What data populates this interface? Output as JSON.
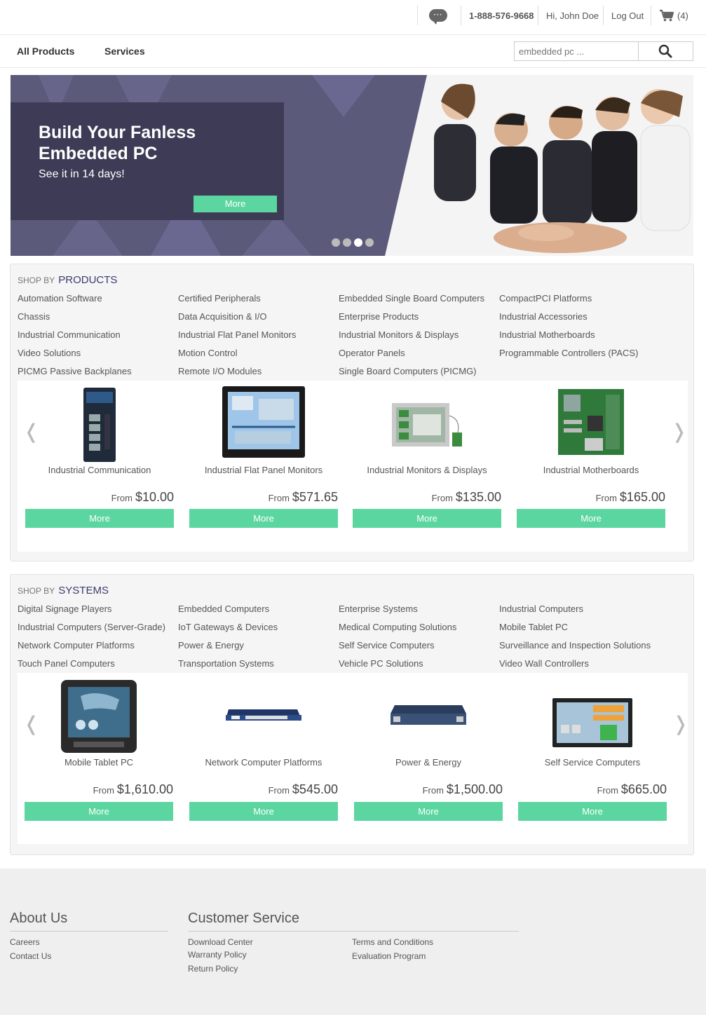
{
  "topbar": {
    "chat_icon": "chat-bubble-icon",
    "phone": "1-888-576-9668",
    "greeting": "Hi, John Doe",
    "logout": "Log Out",
    "cart_count": "(4)"
  },
  "nav": {
    "all_products": "All Products",
    "services": "Services",
    "search_placeholder": "embedded pc ..."
  },
  "hero": {
    "title": "Build Your Fanless Embedded PC",
    "subtitle": "See it in 14 days!",
    "button": "More",
    "slide_count": 4,
    "active_slide": 3
  },
  "products": {
    "prefix": "SHOP BY",
    "heading": "PRODUCTS",
    "links": [
      "Automation Software",
      "Certified Peripherals",
      "Embedded Single Board Computers",
      "CompactPCI Platforms",
      "Chassis",
      "Data Acquisition & I/O",
      "Enterprise Products",
      "Industrial Accessories",
      "Industrial Communication",
      "Industrial Flat Panel Monitors",
      "Industrial Monitors & Displays",
      "Industrial Motherboards",
      "Video Solutions",
      "Motion Control",
      "Operator Panels",
      "Programmable Controllers (PACS)",
      "PICMG Passive Backplanes",
      "Remote I/O Modules",
      "Single Board Computers (PICMG)"
    ],
    "cards": [
      {
        "name": "Industrial Communication",
        "from": "From",
        "price": "$10.00",
        "button": "More"
      },
      {
        "name": "Industrial Flat Panel Monitors",
        "from": "From",
        "price": "$571.65",
        "button": "More"
      },
      {
        "name": "Industrial Monitors & Displays",
        "from": "From",
        "price": "$135.00",
        "button": "More"
      },
      {
        "name": "Industrial Motherboards",
        "from": "From",
        "price": "$165.00",
        "button": "More"
      }
    ]
  },
  "systems": {
    "prefix": "SHOP BY",
    "heading": "SYSTEMS",
    "links": [
      "Digital Signage Players",
      "Embedded Computers",
      "Enterprise Systems",
      "Industrial Computers",
      "Industrial Computers (Server-Grade)",
      "IoT Gateways & Devices",
      "Medical Computing Solutions",
      "Mobile Tablet PC",
      "Network Computer Platforms",
      "Power & Energy",
      "Self Service Computers",
      "Surveillance and Inspection Solutions",
      "Touch Panel Computers",
      "Transportation Systems",
      "Vehicle PC Solutions",
      "Video Wall Controllers"
    ],
    "cards": [
      {
        "name": "Mobile Tablet PC",
        "from": "From",
        "price": "$1,610.00",
        "button": "More"
      },
      {
        "name": "Network Computer Platforms",
        "from": "From",
        "price": "$545.00",
        "button": "More"
      },
      {
        "name": "Power & Energy",
        "from": "From",
        "price": "$1,500.00",
        "button": "More"
      },
      {
        "name": "Self Service Computers",
        "from": "From",
        "price": "$665.00",
        "button": "More"
      }
    ]
  },
  "footer": {
    "about_heading": "About Us",
    "about_links": [
      "Careers",
      "Contact Us"
    ],
    "service_heading": "Customer Service",
    "service_links_col1": [
      "Download Center",
      "Warranty Policy",
      "Return Policy"
    ],
    "service_links_col2": [
      "Terms and Conditions",
      "Evaluation Program"
    ]
  }
}
